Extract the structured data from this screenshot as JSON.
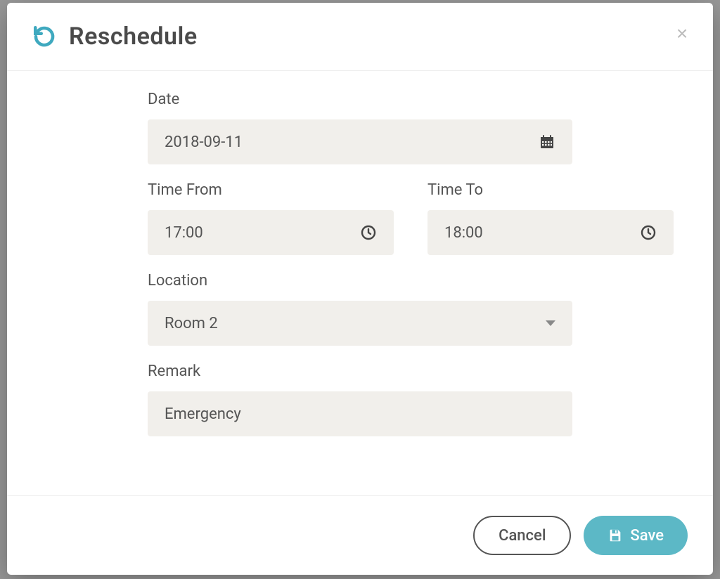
{
  "modal": {
    "title": "Reschedule"
  },
  "form": {
    "date": {
      "label": "Date",
      "value": "2018-09-11"
    },
    "time_from": {
      "label": "Time From",
      "value": "17:00"
    },
    "time_to": {
      "label": "Time To",
      "value": "18:00"
    },
    "location": {
      "label": "Location",
      "value": "Room 2"
    },
    "remark": {
      "label": "Remark",
      "value": "Emergency"
    }
  },
  "footer": {
    "cancel": "Cancel",
    "save": "Save"
  }
}
